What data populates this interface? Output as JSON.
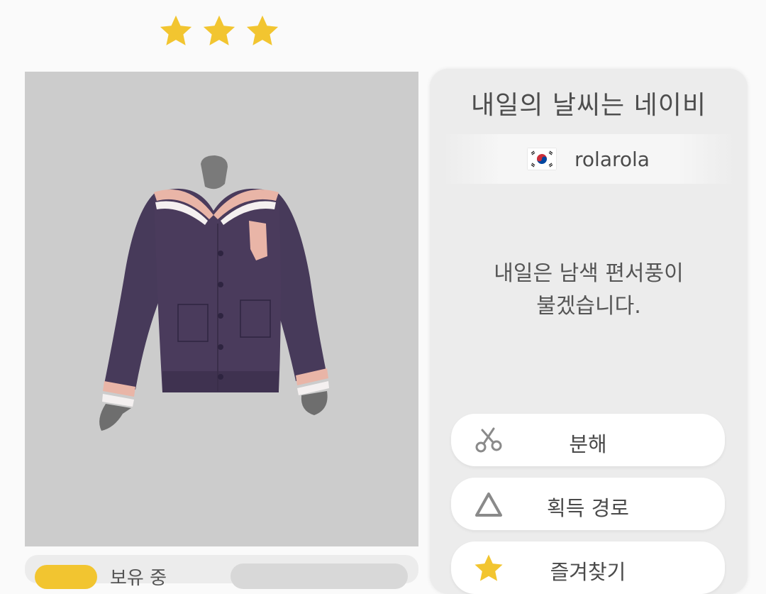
{
  "rating": {
    "stars": 3
  },
  "item": {
    "name": "내일의 날씨는 네이비",
    "designer": "rolarola",
    "description_line1": "내일은 남색 편서풍이",
    "description_line2": "불겠습니다."
  },
  "bottom": {
    "owned_label": "보유 중"
  },
  "actions": {
    "decompose": "분해",
    "acquire_path": "획득 경로",
    "favorite": "즐겨찾기"
  },
  "colors": {
    "star": "#f2c530",
    "jacket": "#4a3b5c",
    "trim": "#e9b5a7",
    "panel": "#cccccc"
  },
  "icons": {
    "decompose": "scissors-icon",
    "acquire_path": "triangle-icon",
    "favorite": "star-icon",
    "flag": "korea-flag-icon"
  }
}
